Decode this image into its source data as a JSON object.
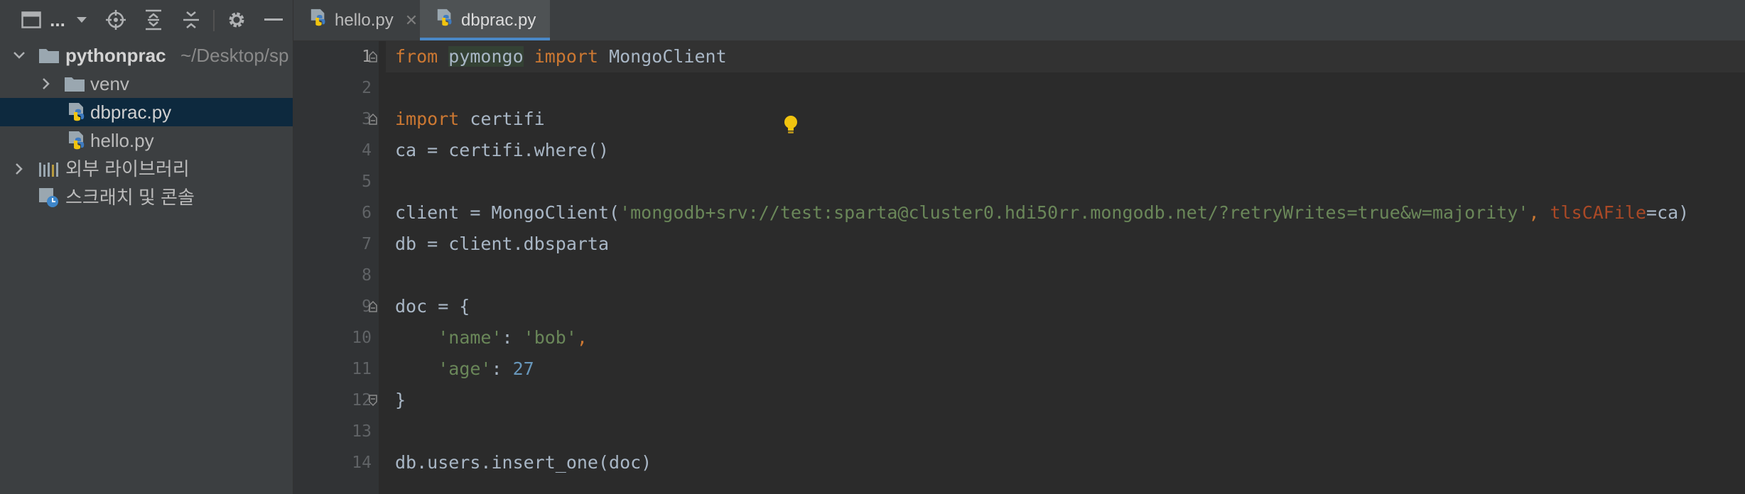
{
  "project_panel": {
    "toolbar": {
      "view_label": "...",
      "icons": [
        "panel-icon",
        "chevron-down-icon",
        "locate-icon",
        "expand-all-icon",
        "collapse-all-icon",
        "gear-icon",
        "minimize-icon"
      ]
    },
    "tree": [
      {
        "name": "pythonprac",
        "path": "~/Desktop/sp",
        "type": "folder",
        "expanded": true
      },
      {
        "name": "venv",
        "type": "folder",
        "expanded": false
      },
      {
        "name": "dbprac.py",
        "type": "python-file",
        "selected": true
      },
      {
        "name": "hello.py",
        "type": "python-file"
      },
      {
        "name": "외부 라이브러리",
        "type": "libraries"
      },
      {
        "name": "스크래치 및 콘솔",
        "type": "scratches"
      }
    ]
  },
  "editor": {
    "tabs": [
      {
        "label": "hello.py",
        "active": false,
        "close": "✕"
      },
      {
        "label": "dbprac.py",
        "active": true,
        "close": ""
      }
    ],
    "line_numbers": [
      "1",
      "2",
      "3",
      "4",
      "5",
      "6",
      "7",
      "8",
      "9",
      "10",
      "11",
      "12",
      "13",
      "14"
    ],
    "current_line": 1,
    "code": {
      "l1_kw1": "from",
      "l1_mod": "pymongo",
      "l1_kw2": "import",
      "l1_rest": "MongoClient",
      "l3_kw": "import",
      "l3_rest": "certifi",
      "l4": "ca = certifi.where()",
      "l6_pre": "client = MongoClient(",
      "l6_str": "'mongodb+srv://test:sparta@cluster0.hdi50rr.mongodb.net/?retryWrites=true&w=majority'",
      "l6_comma": ", ",
      "l6_param": "tlsCAFile",
      "l6_post": "=ca)",
      "l7": "db = client.dbsparta",
      "l9": "doc = {",
      "l10_key": "'name'",
      "l10_sep": ": ",
      "l10_val": "'bob'",
      "l10_comma": ",",
      "l11_key": "'age'",
      "l11_sep": ": ",
      "l11_val": "27",
      "l12": "}",
      "l14": "db.users.insert_one(doc)"
    },
    "colors": {
      "keyword": "#cc7832",
      "string": "#6a8759",
      "number": "#6897bb",
      "parameter": "#aa4926",
      "text": "#a9b7c6",
      "selection": "#0d293e",
      "tab_underline": "#4a88c7"
    }
  }
}
